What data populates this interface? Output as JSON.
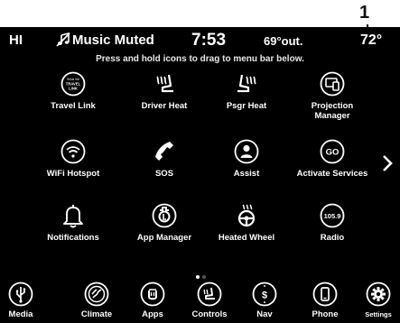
{
  "callout": {
    "number": "1"
  },
  "status": {
    "left_label": "HI",
    "music_status": "Music Muted",
    "time": "7:53",
    "outside_temp": "69°out.",
    "set_temp": "72°"
  },
  "hint": "Press and hold icons to drag to menu bar below.",
  "apps": [
    {
      "label": "Travel Link",
      "icon": "travel-link-icon",
      "icon_text": [
        "Sirius XM",
        "TRAVEL",
        "LINK"
      ]
    },
    {
      "label": "Driver Heat",
      "icon": "driver-heated-seat-icon"
    },
    {
      "label": "Psgr Heat",
      "icon": "passenger-heated-seat-icon"
    },
    {
      "label": "Projection",
      "label2": "Manager",
      "icon": "projection-manager-icon"
    },
    {
      "label": "WiFi Hotspot",
      "icon": "wifi-icon"
    },
    {
      "label": "SOS",
      "icon": "phone-handset-icon"
    },
    {
      "label": "Assist",
      "icon": "assist-person-icon"
    },
    {
      "label": "Activate Services",
      "icon": "go-icon",
      "icon_text": "GO"
    },
    {
      "label": "Notifications",
      "icon": "bell-icon"
    },
    {
      "label": "App Manager",
      "icon": "app-manager-icon"
    },
    {
      "label": "Heated Wheel",
      "icon": "heated-steering-wheel-icon"
    },
    {
      "label": "Radio",
      "icon": "radio-icon",
      "icon_text": "105.9"
    }
  ],
  "pager": {
    "pages": 2,
    "current": 1
  },
  "menubar": [
    {
      "label": "Media",
      "icon": "usb-media-icon"
    },
    {
      "label": "Climate",
      "icon": "climate-icon"
    },
    {
      "label": "Apps",
      "icon": "apps-icon"
    },
    {
      "label": "Controls",
      "icon": "controls-icon"
    },
    {
      "label": "Nav",
      "icon": "nav-icon"
    },
    {
      "label": "Phone",
      "icon": "phone-icon"
    },
    {
      "label": "Settings",
      "icon": "gear-icon"
    }
  ],
  "colors": {
    "background": "#000000",
    "text": "#ffffff",
    "dot_active": "#ffffff",
    "dot_inactive": "#555555"
  }
}
